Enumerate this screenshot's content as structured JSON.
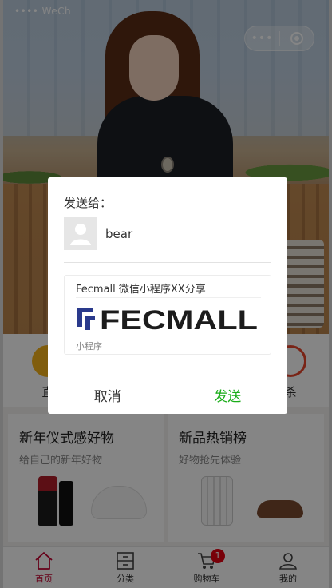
{
  "status_bar": {
    "carrier": "•••• WeCh"
  },
  "capsule": {
    "menu_icon": "more-dots-icon",
    "close_icon": "target-circle-icon"
  },
  "quick_menu": {
    "left_label": "直",
    "right_label": "杀"
  },
  "promo": {
    "left": {
      "title": "新年仪式感好物",
      "subtitle": "给自己的新年好物"
    },
    "right": {
      "title": "新品热销榜",
      "subtitle": "好物抢先体验"
    }
  },
  "tabbar": {
    "items": [
      {
        "label": "首页",
        "icon": "home-icon",
        "active": true
      },
      {
        "label": "分类",
        "icon": "category-icon",
        "active": false
      },
      {
        "label": "购物车",
        "icon": "cart-icon",
        "active": false,
        "badge": "1"
      },
      {
        "label": "我的",
        "icon": "user-icon",
        "active": false
      }
    ]
  },
  "share_dialog": {
    "heading": "发送给：",
    "recipient": {
      "name": "bear",
      "avatar_icon": "default-avatar-icon"
    },
    "card": {
      "title": "Fecmall 微信小程序XX分享",
      "logo_text": "FECMALL",
      "footer": "小程序"
    },
    "cancel_label": "取消",
    "send_label": "发送",
    "colors": {
      "send": "#1aad19",
      "logo": "#1c1c1c",
      "logo_accent": "#2a3a8c"
    }
  }
}
